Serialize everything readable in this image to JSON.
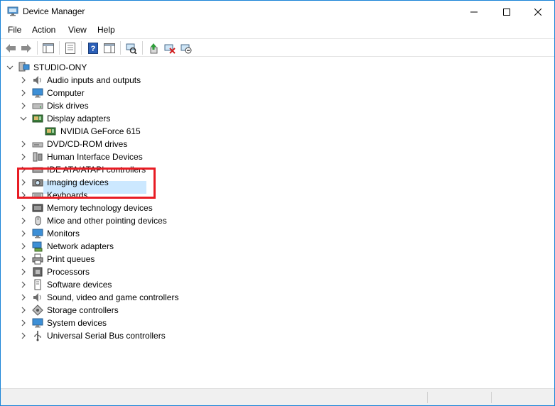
{
  "window": {
    "title": "Device Manager"
  },
  "menu": {
    "file": "File",
    "action": "Action",
    "view": "View",
    "help": "Help"
  },
  "tree": {
    "root": "STUDIO-ONY",
    "categories": [
      {
        "label": "Audio inputs and outputs",
        "icon": "speaker-icon"
      },
      {
        "label": "Computer",
        "icon": "monitor-icon"
      },
      {
        "label": "Disk drives",
        "icon": "disk-drive-icon"
      },
      {
        "label": "Display adapters",
        "icon": "display-adapter-icon",
        "expanded": true,
        "children": [
          {
            "label": "NVIDIA GeForce 615",
            "icon": "display-adapter-icon",
            "selected": true
          }
        ]
      },
      {
        "label": "DVD/CD-ROM drives",
        "icon": "dvd-drive-icon"
      },
      {
        "label": "Human Interface Devices",
        "icon": "hid-icon"
      },
      {
        "label": "IDE ATA/ATAPI controllers",
        "icon": "ide-controller-icon"
      },
      {
        "label": "Imaging devices",
        "icon": "camera-icon"
      },
      {
        "label": "Keyboards",
        "icon": "keyboard-icon"
      },
      {
        "label": "Memory technology devices",
        "icon": "memory-icon"
      },
      {
        "label": "Mice and other pointing devices",
        "icon": "mouse-icon"
      },
      {
        "label": "Monitors",
        "icon": "monitor-icon"
      },
      {
        "label": "Network adapters",
        "icon": "network-icon"
      },
      {
        "label": "Print queues",
        "icon": "printer-icon"
      },
      {
        "label": "Processors",
        "icon": "processor-icon"
      },
      {
        "label": "Software devices",
        "icon": "software-device-icon"
      },
      {
        "label": "Sound, video and game controllers",
        "icon": "speaker-icon"
      },
      {
        "label": "Storage controllers",
        "icon": "storage-controller-icon"
      },
      {
        "label": "System devices",
        "icon": "monitor-icon"
      },
      {
        "label": "Universal Serial Bus controllers",
        "icon": "usb-icon"
      }
    ]
  },
  "colors": {
    "accent": "#1883d7",
    "selection": "#cce8ff",
    "highlight_box": "#e81c24"
  }
}
